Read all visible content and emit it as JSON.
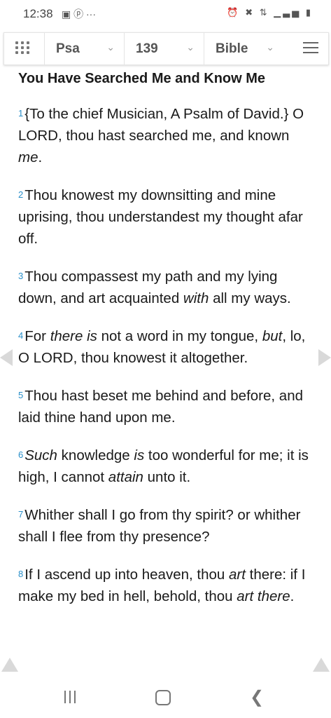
{
  "status_bar": {
    "time": "12:38",
    "left_icons": "▣ ⓟ ···",
    "right_icons": "⏰ ✖ ⇅ ▁▃▅ ▮"
  },
  "toolbar": {
    "book": "Psa",
    "chapter": "139",
    "version": "Bible"
  },
  "passage": {
    "heading": "You Have Searched Me and Know Me",
    "verses": [
      {
        "n": "1",
        "html": "{To the chief Musician, A Psalm of David.} O LORD, thou hast searched me, and known <i>me</i>."
      },
      {
        "n": "2",
        "html": "Thou knowest my downsitting and mine uprising, thou understandest my thought afar off."
      },
      {
        "n": "3",
        "html": "Thou compassest my path and my lying down, and art acquainted <i>with</i> all my ways."
      },
      {
        "n": "4",
        "html": "For <i>there is</i> not a word in my tongue, <i>but</i>, lo, O LORD, thou knowest it altogether."
      },
      {
        "n": "5",
        "html": "Thou hast beset me behind and before, and laid thine hand upon me."
      },
      {
        "n": "6",
        "html": "<i>Such</i> knowledge <i>is</i> too wonderful for me; it is high, I cannot <i>attain</i> unto it."
      },
      {
        "n": "7",
        "html": "Whither shall I go from thy spirit? or whither shall I flee from thy presence?"
      },
      {
        "n": "8",
        "html": "If I ascend up into heaven, thou <i>art</i> there: if I make my bed in hell, behold, thou <i>art there</i>."
      }
    ]
  },
  "colors": {
    "verse_number": "#2a8fc9",
    "text": "#1a1a1a",
    "arrow": "#d9d9d9"
  },
  "icons": {
    "status_left": [
      "gallery-icon",
      "pinterest-icon",
      "more-dots-icon"
    ],
    "status_right": [
      "alarm-icon",
      "mute-icon",
      "data-icon",
      "signal-icon",
      "battery-icon"
    ],
    "toolbar": [
      "grid-icon",
      "chevron-down-icon",
      "menu-icon"
    ],
    "navigation": [
      "recents-icon",
      "home-icon",
      "back-icon"
    ]
  }
}
